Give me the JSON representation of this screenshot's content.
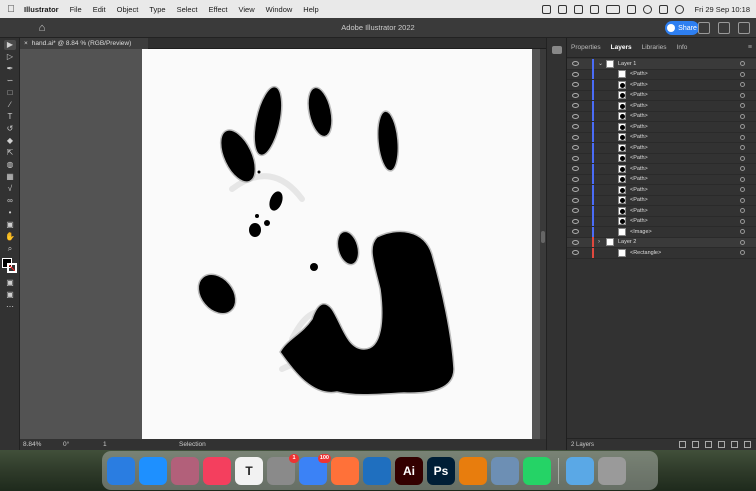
{
  "menubar": {
    "app_name": "Illustrator",
    "items": [
      "File",
      "Edit",
      "Object",
      "Type",
      "Select",
      "Effect",
      "View",
      "Window",
      "Help"
    ],
    "clock": "Fri 29 Sep  10:18"
  },
  "window": {
    "title": "Adobe Illustrator 2022",
    "share_label": "Share"
  },
  "document": {
    "tab_label": "hand.ai* @ 8.84 % (RGB/Preview)",
    "close_glyph": "×"
  },
  "statusbar": {
    "zoom": "8.84%",
    "rotation": "0°",
    "artboard": "1",
    "selection_label": "Selection"
  },
  "panel": {
    "tabs": [
      "Properties",
      "Layers",
      "Libraries",
      "Info"
    ],
    "active_tab": "Layers",
    "layers": [
      {
        "name": "Layer 1",
        "level": 0,
        "color": "#4a6cf7",
        "thumb": "light",
        "expanded": true
      },
      {
        "name": "<Path>",
        "level": 1,
        "color": "#4a6cf7",
        "thumb": "light"
      },
      {
        "name": "<Path>",
        "level": 1,
        "color": "#4a6cf7",
        "thumb": "dark"
      },
      {
        "name": "<Path>",
        "level": 1,
        "color": "#4a6cf7",
        "thumb": "dark"
      },
      {
        "name": "<Path>",
        "level": 1,
        "color": "#4a6cf7",
        "thumb": "dark"
      },
      {
        "name": "<Path>",
        "level": 1,
        "color": "#4a6cf7",
        "thumb": "dark"
      },
      {
        "name": "<Path>",
        "level": 1,
        "color": "#4a6cf7",
        "thumb": "dark"
      },
      {
        "name": "<Path>",
        "level": 1,
        "color": "#4a6cf7",
        "thumb": "dark"
      },
      {
        "name": "<Path>",
        "level": 1,
        "color": "#4a6cf7",
        "thumb": "dark"
      },
      {
        "name": "<Path>",
        "level": 1,
        "color": "#4a6cf7",
        "thumb": "dark"
      },
      {
        "name": "<Path>",
        "level": 1,
        "color": "#4a6cf7",
        "thumb": "dark"
      },
      {
        "name": "<Path>",
        "level": 1,
        "color": "#4a6cf7",
        "thumb": "dark"
      },
      {
        "name": "<Path>",
        "level": 1,
        "color": "#4a6cf7",
        "thumb": "dark"
      },
      {
        "name": "<Path>",
        "level": 1,
        "color": "#4a6cf7",
        "thumb": "dark"
      },
      {
        "name": "<Path>",
        "level": 1,
        "color": "#4a6cf7",
        "thumb": "dark"
      },
      {
        "name": "<Path>",
        "level": 1,
        "color": "#4a6cf7",
        "thumb": "dark"
      },
      {
        "name": "<Image>",
        "level": 1,
        "color": "#4a6cf7",
        "thumb": "light"
      },
      {
        "name": "Layer 2",
        "level": 0,
        "color": "#e0483e",
        "thumb": "light",
        "expanded": false
      },
      {
        "name": "<Rectangle>",
        "level": 1,
        "color": "#e0483e",
        "thumb": "light"
      }
    ],
    "footer_label": "2 Layers"
  },
  "dock": {
    "apps": [
      {
        "name": "Finder",
        "label": "",
        "color": "#2a7de1"
      },
      {
        "name": "Safari",
        "label": "",
        "color": "#1e90ff"
      },
      {
        "name": "Launchpad",
        "label": "",
        "color": "#b2607a"
      },
      {
        "name": "Music",
        "label": "",
        "color": "#f43f5e"
      },
      {
        "name": "TextEdit",
        "label": "T",
        "color": "#f2f2f2"
      },
      {
        "name": "System Settings",
        "label": "",
        "color": "#8a8a8a",
        "badge": "1"
      },
      {
        "name": "Mail",
        "label": "",
        "color": "#3b82f6",
        "badge": "100"
      },
      {
        "name": "Firefox",
        "label": "",
        "color": "#ff7139"
      },
      {
        "name": "VS Code",
        "label": "",
        "color": "#1f6fbf"
      },
      {
        "name": "Illustrator",
        "label": "Ai",
        "color": "#330000"
      },
      {
        "name": "Photoshop",
        "label": "Ps",
        "color": "#001e36"
      },
      {
        "name": "Blender",
        "label": "",
        "color": "#e87d0d"
      },
      {
        "name": "Preview",
        "label": "",
        "color": "#6d8fb4"
      },
      {
        "name": "WhatsApp",
        "label": "",
        "color": "#25d366"
      },
      {
        "name": "Downloads",
        "label": "",
        "color": "#5aa8e6"
      },
      {
        "name": "Trash",
        "label": "",
        "color": "#9a9a9a"
      }
    ]
  }
}
